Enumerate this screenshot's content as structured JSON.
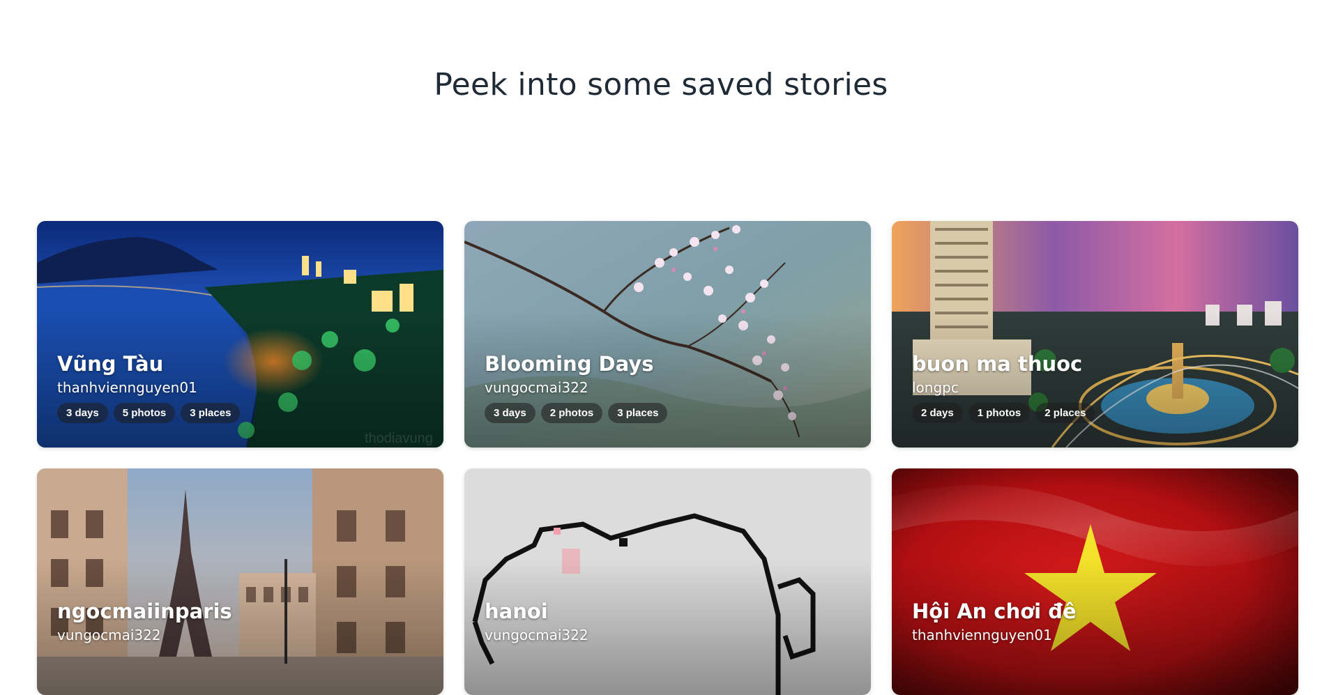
{
  "section": {
    "heading": "Peek into some saved stories"
  },
  "stories": [
    {
      "title": "Vũng Tàu",
      "author": "thanhviennguyen01",
      "days": "3 days",
      "photos": "5 photos",
      "places": "3 places",
      "watermark": "thodiavung"
    },
    {
      "title": "Blooming Days",
      "author": "vungocmai322",
      "days": "3 days",
      "photos": "2 photos",
      "places": "3 places"
    },
    {
      "title": "buon ma thuoc",
      "author": "longpc",
      "days": "2 days",
      "photos": "1 photos",
      "places": "2 places"
    },
    {
      "title": "ngocmaiinparis",
      "author": "vungocmai322"
    },
    {
      "title": "hanoi",
      "author": "vungocmai322"
    },
    {
      "title": "Hội An chơi đê",
      "author": "thanhviennguyen01"
    }
  ],
  "colors": {
    "heading": "#1f2a37",
    "badge_bg": "rgba(30,30,30,0.55)"
  }
}
